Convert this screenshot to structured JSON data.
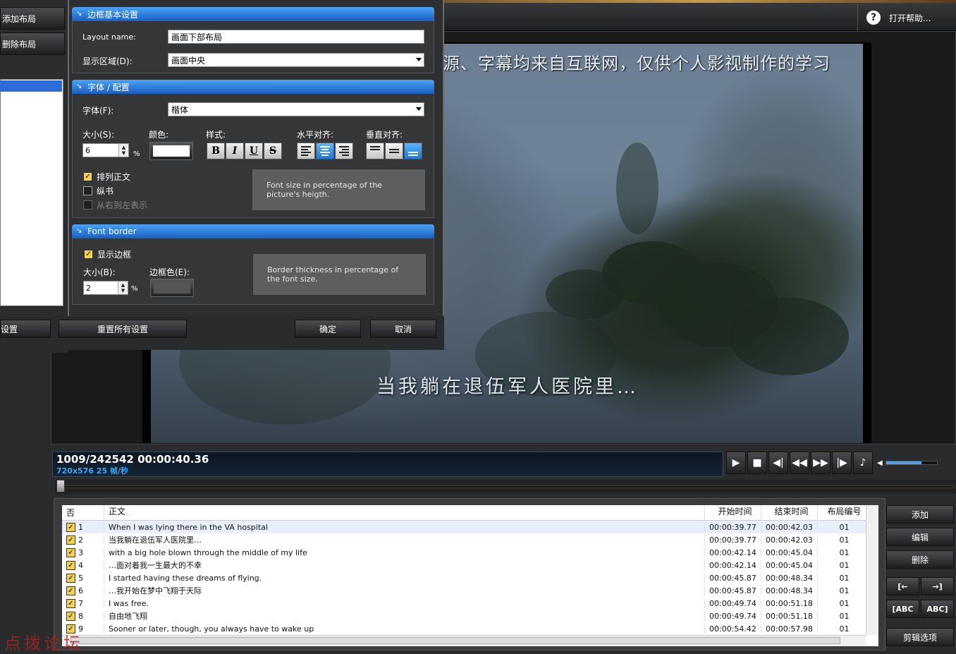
{
  "help": {
    "label": "打开帮助..."
  },
  "sidebar": {
    "add_layout": "添加布局",
    "delete_layout": "删除布局",
    "set_label": "设置"
  },
  "dialog": {
    "section1": {
      "title": "边框基本设置",
      "layout_name_label": "Layout name:",
      "layout_name_value": "画面下部布局",
      "display_area_label": "显示区域(D):",
      "display_area_value": "画面中央"
    },
    "section2": {
      "title": "字体 / 配置",
      "font_label": "字体(F):",
      "font_value": "楷体",
      "size_label": "大小(S):",
      "size_value": "6",
      "size_unit": "%",
      "color_label": "颜色:",
      "style_label": "样式:",
      "halign_label": "水平对齐:",
      "valign_label": "垂直对齐:",
      "style_buttons": [
        "B",
        "I",
        "U",
        "S"
      ],
      "check_arrange": "排列正文",
      "check_vertical": "纵书",
      "check_rtl": "从右到左表示",
      "hint": "Font size in percentage of the picture's heigth."
    },
    "section3": {
      "title": "Font border",
      "check_show_border": "显示边框",
      "size_label": "大小(B):",
      "size_value": "2",
      "size_unit": "%",
      "border_color_label": "边框色(E):",
      "hint": "Border thickness in percentage of the font size."
    },
    "footer": {
      "reset_all": "重置所有设置",
      "ok": "确定",
      "cancel": "取消"
    }
  },
  "video": {
    "subtitle_top": "源、字幕均来自互联网，仅供个人影视制作的学习",
    "subtitle_main": "当我躺在退伍军人医院里…"
  },
  "timecode": {
    "frame": "1009/242542  00:00:40.36",
    "info": "720x576 25 帧/秒"
  },
  "volume_level": 0.7,
  "table": {
    "headers": [
      "否",
      "正文",
      "开始时间",
      "结束时间",
      "布局编号"
    ],
    "rows": [
      {
        "n": "1",
        "text": "When I was lying there in the VA hospital",
        "start": "00:00:39.77",
        "end": "00:00:42.03",
        "layout": "01"
      },
      {
        "n": "2",
        "text": "当我躺在退伍军人医院里…",
        "start": "00:00:39.77",
        "end": "00:00:42.03",
        "layout": "01"
      },
      {
        "n": "3",
        "text": "with a big hole blown through the middle of my life",
        "start": "00:00:42.14",
        "end": "00:00:45.04",
        "layout": "01"
      },
      {
        "n": "4",
        "text": "…面对着我一生最大的不幸",
        "start": "00:00:42.14",
        "end": "00:00:45.04",
        "layout": "01"
      },
      {
        "n": "5",
        "text": "I started having these dreams of flying.",
        "start": "00:00:45.87",
        "end": "00:00:48.34",
        "layout": "01"
      },
      {
        "n": "6",
        "text": "…我开始在梦中飞翔于天际",
        "start": "00:00:45.87",
        "end": "00:00:48.34",
        "layout": "01"
      },
      {
        "n": "7",
        "text": "I was free.",
        "start": "00:00:49.74",
        "end": "00:00:51.18",
        "layout": "01"
      },
      {
        "n": "8",
        "text": "自由地飞翔",
        "start": "00:00:49.74",
        "end": "00:00:51.18",
        "layout": "01"
      },
      {
        "n": "9",
        "text": "Sooner or later, though, you always have to wake up",
        "start": "00:00:54.42",
        "end": "00:00:57.98",
        "layout": "01"
      }
    ]
  },
  "right_buttons": {
    "add": "添加",
    "edit": "编辑",
    "delete": "删除",
    "edit_options": "剪辑选项",
    "abc_left": "ABC",
    "abc_right": "ABC"
  },
  "watermark": "点拨论坛",
  "colors": {
    "accent": "#2e6bd8",
    "timecode_info": "#36a4ff",
    "checkbox": "#f6d24a"
  }
}
